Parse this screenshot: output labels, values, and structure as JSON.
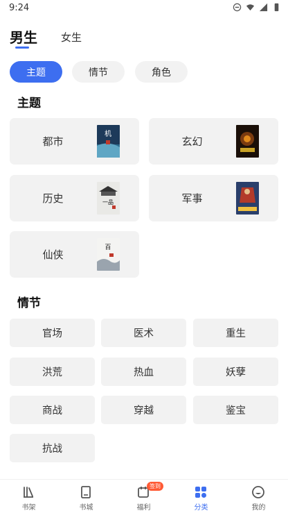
{
  "status_bar": {
    "time": "9:24"
  },
  "gender_tabs": {
    "male": "男生",
    "female": "女生"
  },
  "segments": {
    "theme": "主题",
    "plot": "情节",
    "role": "角色"
  },
  "sections": {
    "theme": "主题",
    "plot": "情节"
  },
  "themes": [
    {
      "label": "都市",
      "cover_text": "机"
    },
    {
      "label": "玄幻",
      "cover_text": ""
    },
    {
      "label": "历史",
      "cover_text": "一品"
    },
    {
      "label": "军事",
      "cover_text": ""
    },
    {
      "label": "仙侠",
      "cover_text": "百"
    }
  ],
  "plots": [
    "官场",
    "医术",
    "重生",
    "洪荒",
    "热血",
    "妖孽",
    "商战",
    "穿越",
    "鉴宝",
    "抗战"
  ],
  "bottom_nav": {
    "bookshelf": "书架",
    "bookstore": "书城",
    "welfare": "福利",
    "welfare_badge": "签到",
    "category": "分类",
    "mine": "我的"
  },
  "colors": {
    "accent": "#3d6ef0",
    "badge": "#ff5a35",
    "card_bg": "#f2f2f2"
  }
}
